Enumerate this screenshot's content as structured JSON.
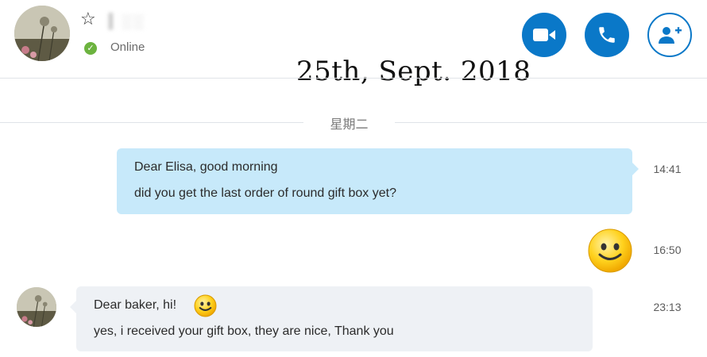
{
  "header": {
    "contact_name": "▍░░",
    "status": "Online",
    "favorite_icon": "star-outline-icon",
    "actions": [
      {
        "name": "video-call-icon",
        "color": "#0a78c8"
      },
      {
        "name": "phone-call-icon",
        "color": "#0a78c8"
      },
      {
        "name": "add-person-icon",
        "color": "#0a78c8"
      }
    ]
  },
  "overlay": {
    "date_text": "25th,  Sept.  2018"
  },
  "conversation": {
    "day_label": "星期二",
    "messages": [
      {
        "direction": "outgoing",
        "lines": [
          "Dear Elisa, good morning",
          "did you get the last order of round gift box yet?"
        ],
        "time": "14:41",
        "bubble_color": "#c7e9fa"
      },
      {
        "direction": "outgoing",
        "emoticon": "smiley-emoticon-icon",
        "time": "16:50"
      },
      {
        "direction": "incoming",
        "lines": [
          "Dear baker, hi!",
          "yes, i received your gift box, they are nice, Thank you"
        ],
        "emoticon": "smiley-emoticon-icon",
        "time": "23:13",
        "bubble_color": "#eef1f5"
      }
    ]
  },
  "colors": {
    "accent": "#0a78c8",
    "online": "#6cb33f"
  }
}
